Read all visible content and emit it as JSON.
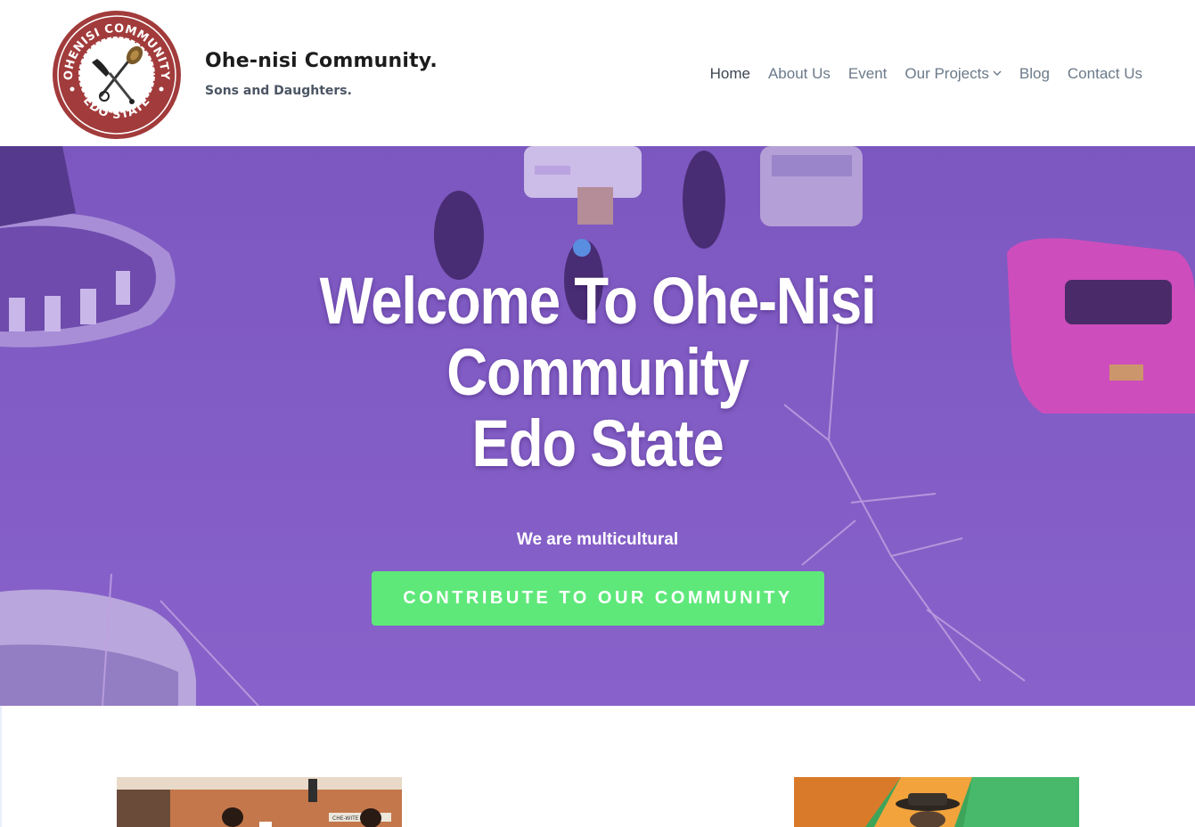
{
  "header": {
    "logo": {
      "ring_text_top": "OHENISI COMMUNITY",
      "ring_text_bottom": "EDO STATE",
      "ring_color": "#a23b3b"
    },
    "site_title": "Ohe-nisi Community.",
    "tagline": "Sons and Daughters."
  },
  "nav": {
    "items": [
      {
        "label": "Home",
        "active": true
      },
      {
        "label": "About Us"
      },
      {
        "label": "Event"
      },
      {
        "label": "Our Projects",
        "icon": "chevron-down-icon"
      },
      {
        "label": "Blog"
      },
      {
        "label": "Contact Us"
      }
    ]
  },
  "hero": {
    "title_lines": [
      "Welcome To Ohe-Nisi",
      "Community",
      "Edo State"
    ],
    "subtitle": "We are multicultural",
    "cta_label": "CONTRIBUTE TO OUR COMMUNITY",
    "tint_color": "#8a66c4",
    "cta_color": "#5fe87a"
  },
  "gallery": {
    "left_sign_text": "CHE-WITE"
  }
}
